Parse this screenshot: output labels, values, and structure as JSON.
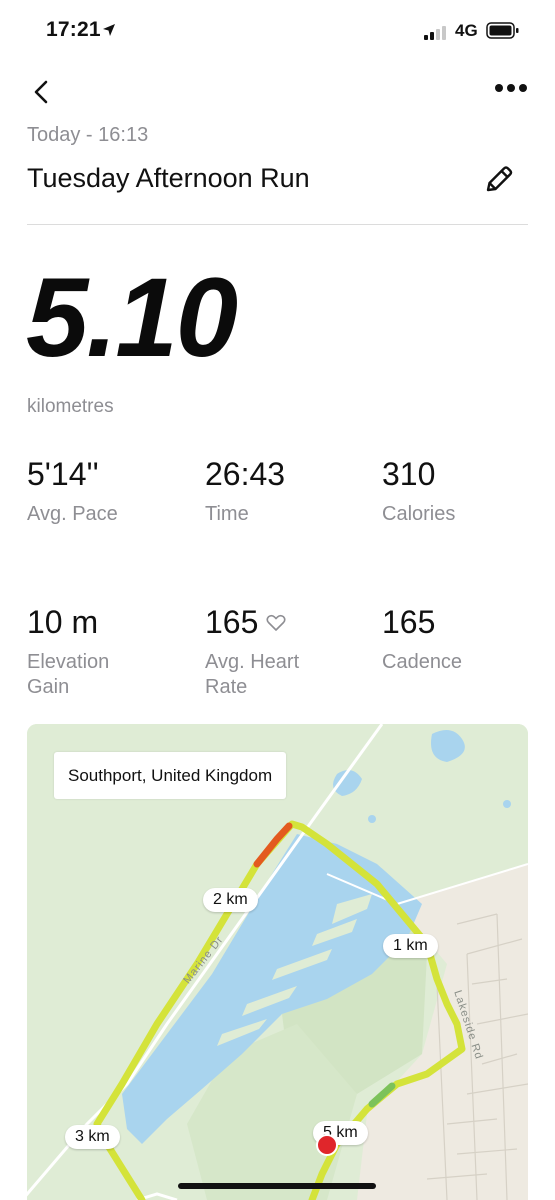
{
  "status_bar": {
    "time": "17:21",
    "network": "4G"
  },
  "header": {
    "date": "Today - 16:13",
    "title": "Tuesday Afternoon Run"
  },
  "distance": {
    "value": "5.10",
    "unit": "kilometres"
  },
  "stats": {
    "pace": {
      "value": "5'14''",
      "label": "Avg. Pace"
    },
    "time": {
      "value": "26:43",
      "label": "Time"
    },
    "calories": {
      "value": "310",
      "label": "Calories"
    },
    "elevation": {
      "value": "10 m",
      "label": "Elevation Gain"
    },
    "heart_rate": {
      "value": "165",
      "label": "Avg. Heart Rate"
    },
    "cadence": {
      "value": "165",
      "label": "Cadence"
    }
  },
  "map": {
    "location": "Southport, United Kingdom",
    "markers": [
      "1 km",
      "2 km",
      "3 km",
      "5 km"
    ],
    "roads": [
      "Marine Dr",
      "Lakeside Rd"
    ]
  },
  "icons": {
    "location": "location-arrow-icon",
    "back": "chevron-left-icon",
    "more": "more-dots-icon",
    "edit": "pencil-icon",
    "heart": "heart-outline-icon"
  },
  "colors": {
    "route": "#d4e33a",
    "route_fast": "#e35a1f",
    "water": "#a9d4ee",
    "end_pin": "#e0262b"
  }
}
